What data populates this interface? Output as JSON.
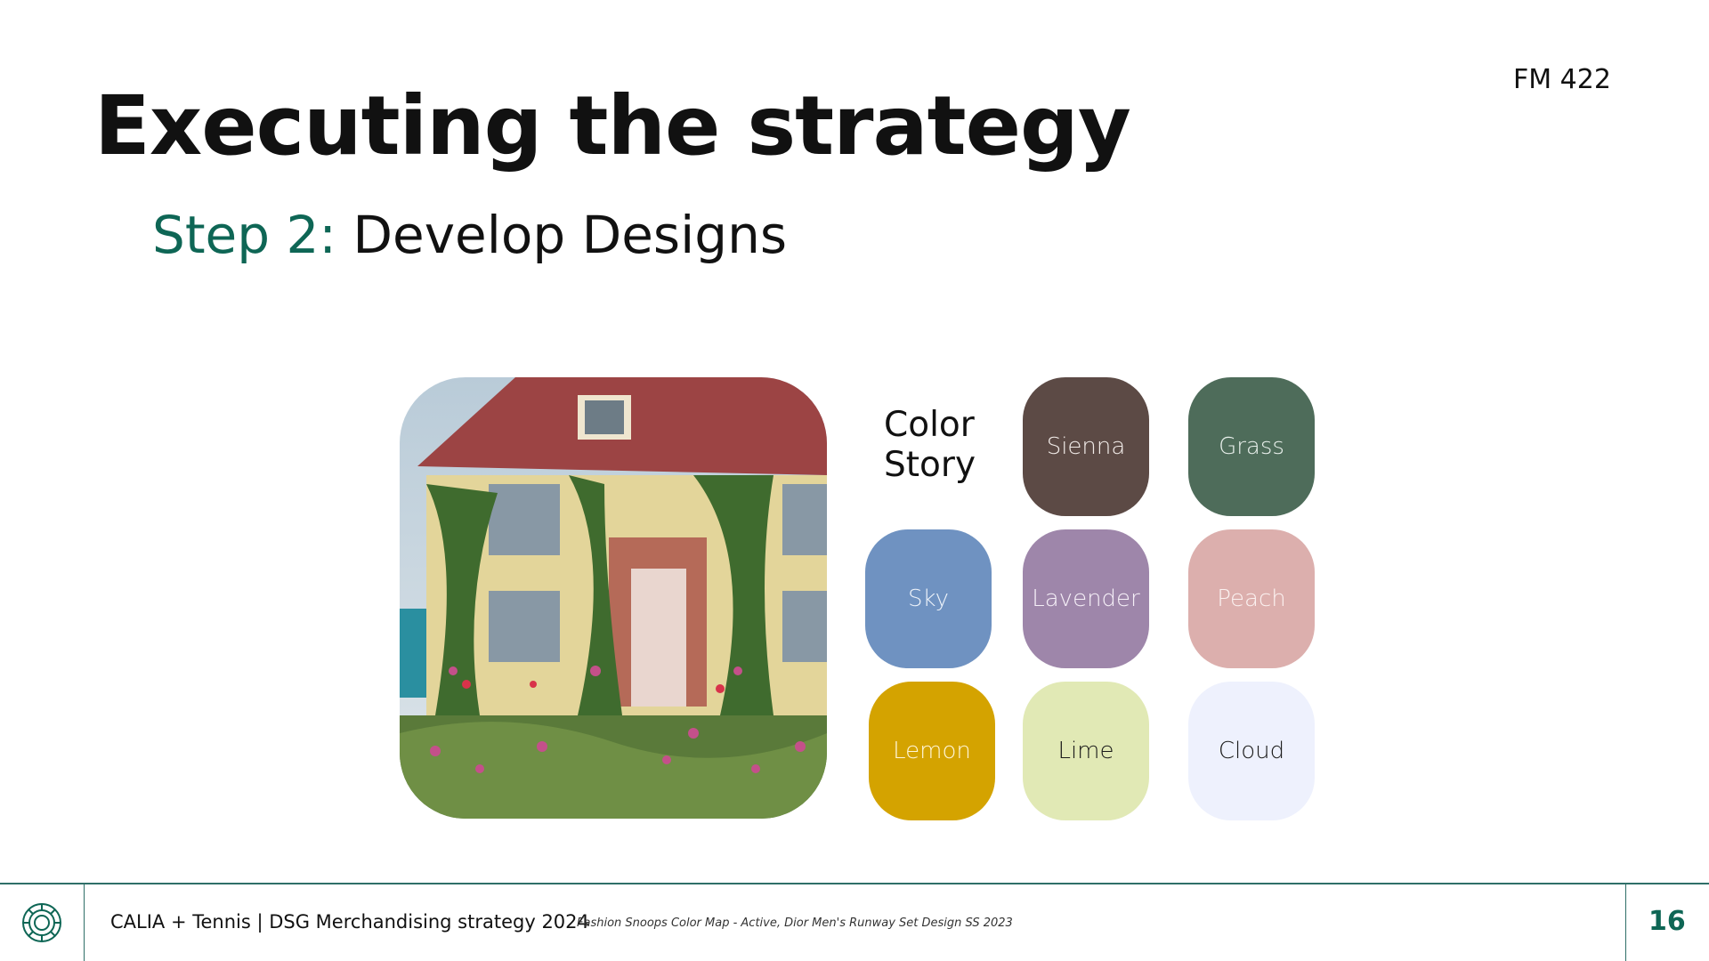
{
  "header": {
    "title": "Executing the strategy",
    "course_code": "FM 422"
  },
  "subtitle": {
    "step": "Step 2:",
    "text": " Develop Designs"
  },
  "image": {
    "description_icon": "cottage-photo"
  },
  "color_story": {
    "label_line1": "Color",
    "label_line2": "Story",
    "swatches": [
      {
        "name": "Sienna",
        "color": "#5c4a45",
        "text_color": "#f2ece9"
      },
      {
        "name": "Grass",
        "color": "#4e6c5a",
        "text_color": "#e9f0ec"
      },
      {
        "name": "Sky",
        "color": "#6f92c1",
        "text_color": "#eef3fa"
      },
      {
        "name": "Lavender",
        "color": "#9e86aa",
        "text_color": "#f6f0f8"
      },
      {
        "name": "Peach",
        "color": "#dcafad",
        "text_color": "#fbf1f0"
      },
      {
        "name": "Lemon",
        "color": "#d4a300",
        "text_color": "#fff6d8"
      },
      {
        "name": "Lime",
        "color": "#e1e9b5",
        "text_color": "#1a1a1a"
      },
      {
        "name": "Cloud",
        "color": "#eef1fd",
        "text_color": "#1a1a1a"
      }
    ]
  },
  "footer": {
    "text": "CALIA + Tennis | DSG Merchandising strategy 2024",
    "caption": "Fashion Snoops Color Map - Active, Dior Men's Runway Set Design SS 2023",
    "page_number": "16",
    "accent": "#0e6655"
  }
}
